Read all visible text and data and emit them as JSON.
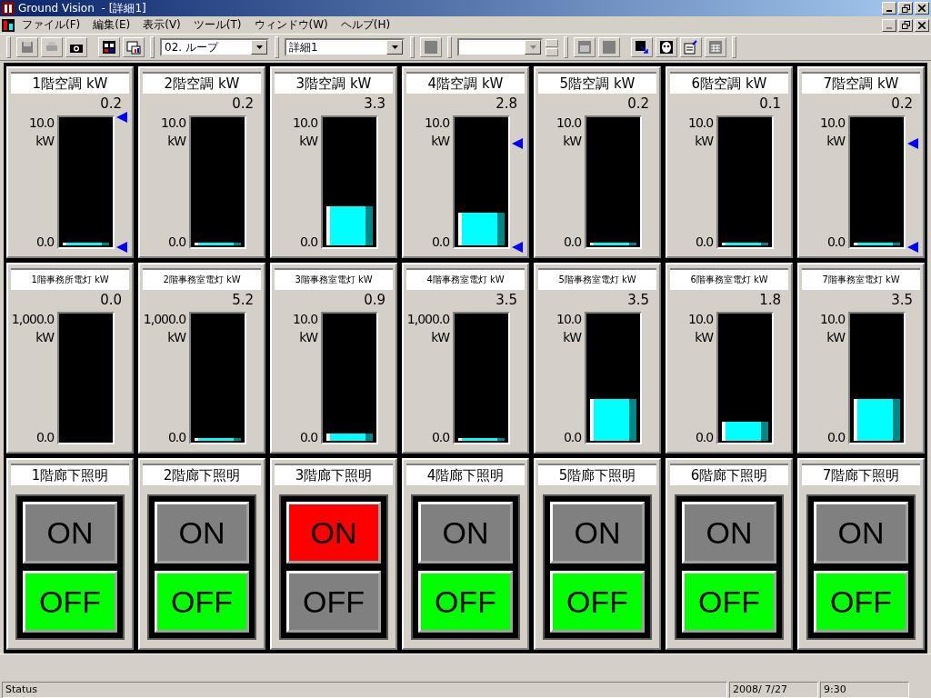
{
  "window": {
    "title": "Ground Vision",
    "document": " - [詳細1]"
  },
  "menu": [
    "ファイル(F)",
    "編集(E)",
    "表示(V)",
    "ツール(T)",
    "ウィンドウ(W)",
    "ヘルプ(H)"
  ],
  "toolbar": {
    "loop_combo": "02. ループ",
    "view_combo": "詳細1"
  },
  "meters": [
    {
      "title": "1階空調 kW",
      "value": "0.2",
      "max": "10.0",
      "unit": "kW",
      "min": "0.0",
      "level": 0.02,
      "limits": [
        {
          "level": 1
        },
        {
          "level": 0
        }
      ]
    },
    {
      "title": "2階空調 kW",
      "value": "0.2",
      "max": "10.0",
      "unit": "kW",
      "min": "0.0",
      "level": 0.02
    },
    {
      "title": "3階空調 kW",
      "value": "3.3",
      "max": "10.0",
      "unit": "kW",
      "min": "0.0",
      "level": 0.33
    },
    {
      "title": "4階空調 kW",
      "value": "2.8",
      "max": "10.0",
      "unit": "kW",
      "min": "0.0",
      "level": 0.28,
      "limits": [
        {
          "level": 0.8
        },
        {
          "level": 0
        }
      ]
    },
    {
      "title": "5階空調 kW",
      "value": "0.2",
      "max": "10.0",
      "unit": "kW",
      "min": "0.0",
      "level": 0.02
    },
    {
      "title": "6階空調 kW",
      "value": "0.1",
      "max": "10.0",
      "unit": "kW",
      "min": "0.0",
      "level": 0.02
    },
    {
      "title": "7階空調 kW",
      "value": "0.2",
      "max": "10.0",
      "unit": "kW",
      "min": "0.0",
      "level": 0.02,
      "limits": [
        {
          "level": 0.8
        },
        {
          "level": 0
        }
      ]
    },
    {
      "title": "1階事務所電灯 kW",
      "value": "0.0",
      "max": "1,000.0",
      "unit": "kW",
      "min": "0.0"
    },
    {
      "title": "2階事務室電灯 kW",
      "value": "5.2",
      "max": "1,000.0",
      "unit": "kW",
      "min": "0.0",
      "level": 0.02
    },
    {
      "title": "3階事務室電灯 kW",
      "value": "0.9",
      "max": "10.0",
      "unit": "kW",
      "min": "0.0",
      "level": 0.09
    },
    {
      "title": "4階事務室電灯 kW",
      "value": "3.5",
      "max": "1,000.0",
      "unit": "kW",
      "min": "0.0",
      "level": 0.01
    },
    {
      "title": "5階事務室電灯 kW",
      "value": "3.5",
      "max": "10.0",
      "unit": "kW",
      "min": "0.0",
      "level": 0.35
    },
    {
      "title": "6階事務室電灯 kW",
      "value": "1.8",
      "max": "10.0",
      "unit": "kW",
      "min": "0.0",
      "level": 0.18
    },
    {
      "title": "7階事務室電灯 kW",
      "value": "3.5",
      "max": "10.0",
      "unit": "kW",
      "min": "0.0",
      "level": 0.35
    }
  ],
  "switches": [
    {
      "title": "1階廊下照明",
      "on_label": "ON",
      "off_label": "OFF",
      "on": false
    },
    {
      "title": "2階廊下照明",
      "on_label": "ON",
      "off_label": "OFF",
      "on": false
    },
    {
      "title": "3階廊下照明",
      "on_label": "ON",
      "off_label": "OFF",
      "on": true
    },
    {
      "title": "4階廊下照明",
      "on_label": "ON",
      "off_label": "OFF",
      "on": false
    },
    {
      "title": "5階廊下照明",
      "on_label": "ON",
      "off_label": "OFF",
      "on": false
    },
    {
      "title": "6階廊下照明",
      "on_label": "ON",
      "off_label": "OFF",
      "on": false
    },
    {
      "title": "7階廊下照明",
      "on_label": "ON",
      "off_label": "OFF",
      "on": false
    }
  ],
  "status_bar": {
    "status": "Status",
    "date": "2008/ 7/27",
    "time": "9:30"
  }
}
